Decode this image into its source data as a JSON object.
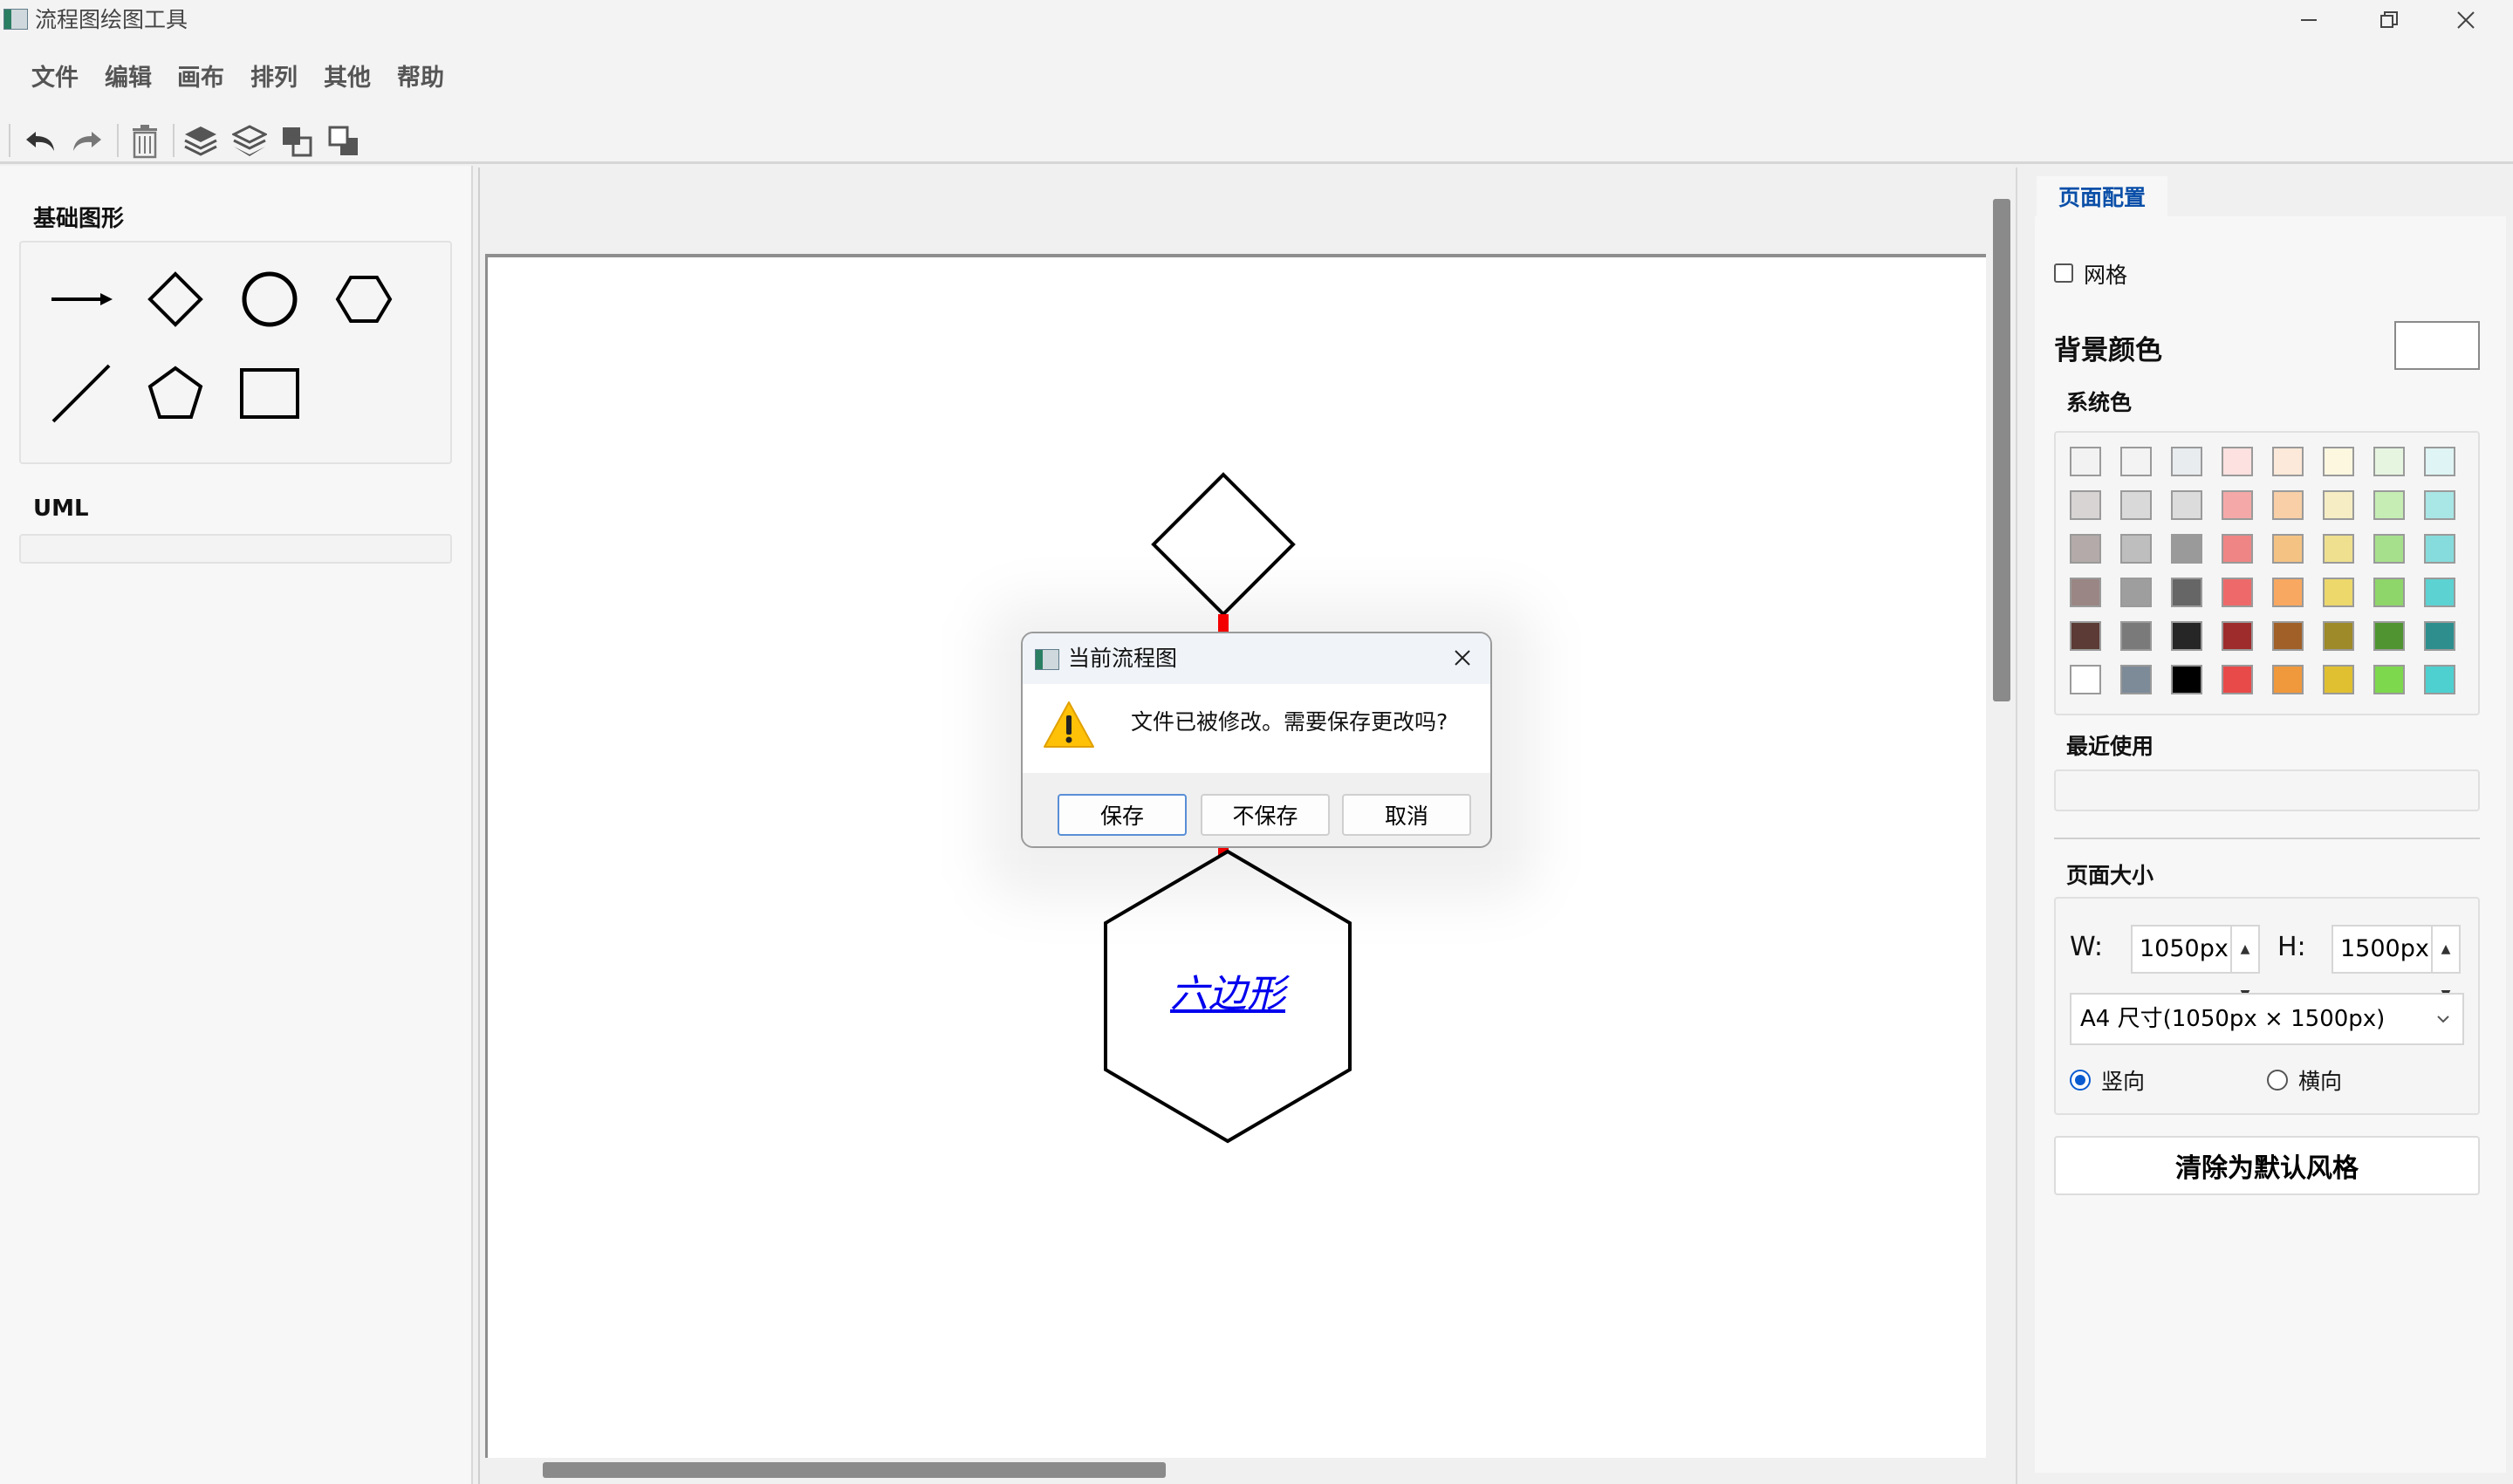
{
  "window": {
    "title": "流程图绘图工具",
    "minimize_icon": "minimize-icon",
    "maximize_icon": "restore-icon",
    "close_icon": "close-icon"
  },
  "menu": [
    "文件",
    "编辑",
    "画布",
    "排列",
    "其他",
    "帮助"
  ],
  "toolbar": [
    "undo-icon",
    "redo-icon",
    "delete-icon",
    "bring-forward-icon",
    "send-backward-icon",
    "bring-to-front-icon",
    "send-to-back-icon"
  ],
  "left_panel": {
    "basic_shapes_title": "基础图形",
    "shapes": [
      "arrow-line",
      "diamond",
      "circle",
      "hexagon",
      "line",
      "pentagon",
      "rectangle"
    ],
    "uml_title": "UML"
  },
  "canvas": {
    "hexagon_label": "六边形",
    "connector_color": "#ff0000",
    "label_color": "#0000ee"
  },
  "right_panel": {
    "tab": "页面配置",
    "grid_label": "网格",
    "grid_checked": false,
    "bg_color_label": "背景颜色",
    "bg_color_value": "#ffffff",
    "system_colors_label": "系统色",
    "palette": [
      [
        "#f2f2f2",
        "#f3f3f3",
        "#e8ecef",
        "#fde0e0",
        "#fde9d9",
        "#fef7e0",
        "#e6f5e0",
        "#dff4f4"
      ],
      [
        "#d8d4d4",
        "#d9d9d9",
        "#dcdcdc",
        "#f5a8a8",
        "#f8cfa6",
        "#f6edc4",
        "#c6edb4",
        "#a9e6e6"
      ],
      [
        "#b3aaa9",
        "#bebebe",
        "#9a9a9a",
        "#ef8585",
        "#f4c383",
        "#efe08f",
        "#a7e08c",
        "#86dcdc"
      ],
      [
        "#9a8684",
        "#9e9e9e",
        "#666666",
        "#ee6a6a",
        "#f8a860",
        "#edd86c",
        "#8fd66a",
        "#5dd2d2"
      ],
      [
        "#5c3a35",
        "#7a7a7a",
        "#262626",
        "#9e2c2c",
        "#a06028",
        "#9e8a28",
        "#4f9430",
        "#2e8e8e"
      ],
      [
        "#ffffff",
        "#7d8b98",
        "#000000",
        "#e84a4a",
        "#ef983c",
        "#e0c030",
        "#7ed84e",
        "#4ed0d0"
      ]
    ],
    "recent_label": "最近使用",
    "page_size_label": "页面大小",
    "width_label": "W:",
    "width_value": "1050px",
    "height_label": "H:",
    "height_value": "1500px",
    "preset": "A4 尺寸(1050px × 1500px)",
    "portrait_label": "竖向",
    "landscape_label": "横向",
    "orientation": "portrait",
    "reset_button": "清除为默认风格"
  },
  "dialog": {
    "title": "当前流程图",
    "message": "文件已被修改。需要保存更改吗?",
    "icon": "warning-icon",
    "buttons": {
      "save": "保存",
      "dont_save": "不保存",
      "cancel": "取消"
    }
  }
}
